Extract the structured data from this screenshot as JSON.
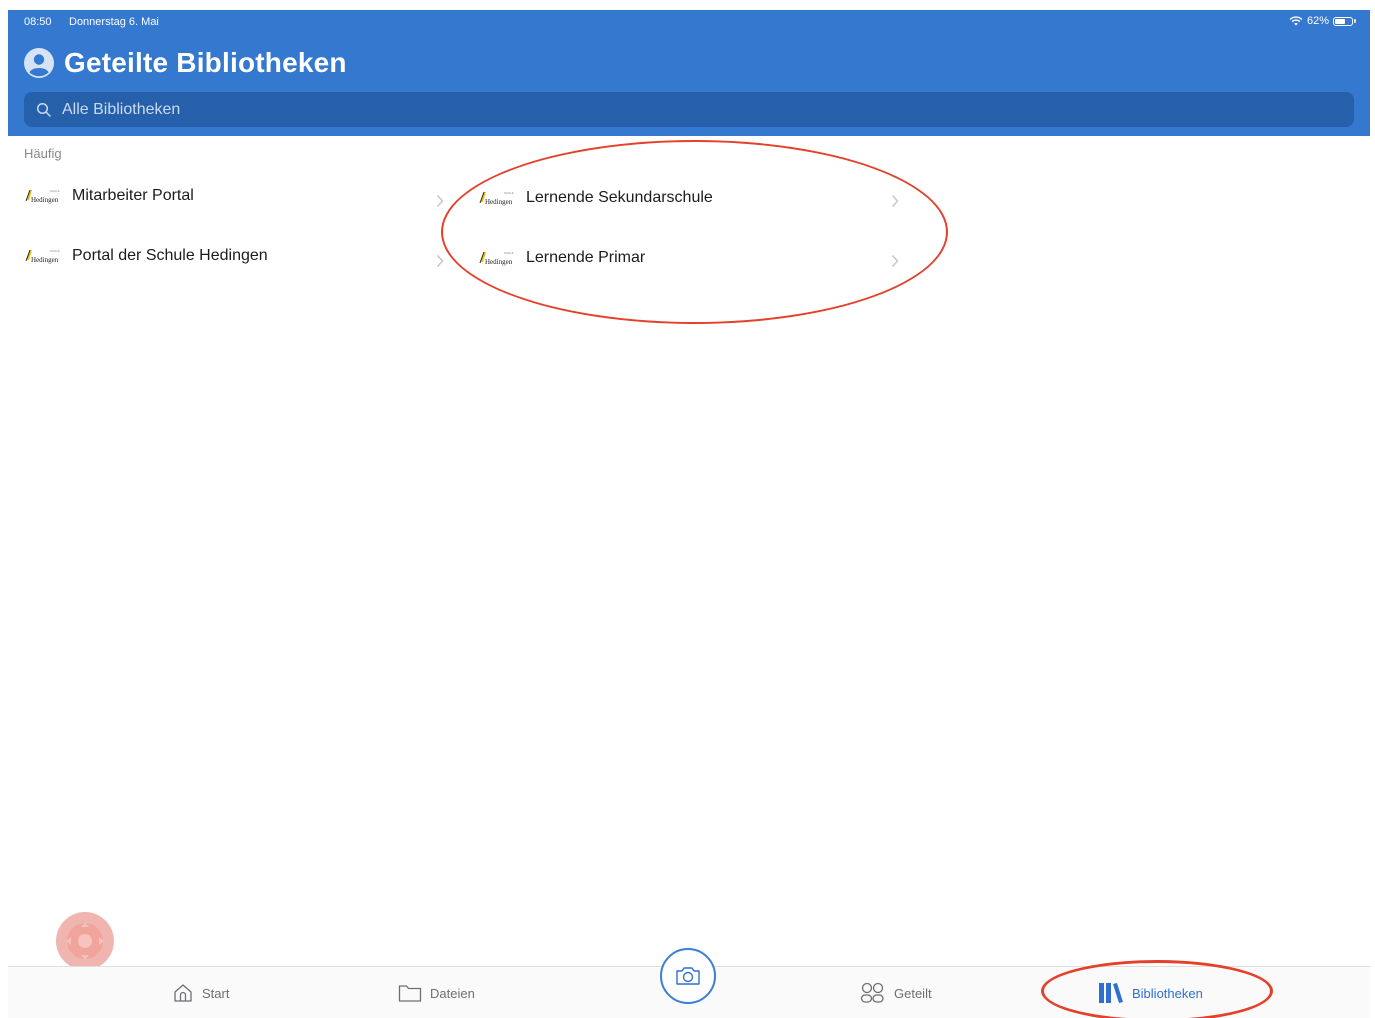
{
  "statusbar": {
    "time": "08:50",
    "date": "Donnerstag 6. Mai",
    "battery": "62%",
    "battery_level": 0.62
  },
  "header": {
    "title": "Geteilte Bibliotheken"
  },
  "search": {
    "placeholder": "Alle Bibliotheken"
  },
  "section": {
    "label": "Häufig"
  },
  "libraries": [
    {
      "label": "Mitarbeiter Portal"
    },
    {
      "label": "Lernende Sekundarschule"
    },
    {
      "label": "Portal der Schule Hedingen"
    },
    {
      "label": "Lernende Primar"
    }
  ],
  "tabbar": {
    "start": "Start",
    "dateien": "Dateien",
    "geteilt": "Geteilt",
    "bibliotheken": "Bibliotheken"
  },
  "colors": {
    "header": "#3478cf",
    "accent": "#2f6fd1",
    "annotation": "#e4402a"
  },
  "icons": [
    "avatar-icon",
    "search-icon",
    "hedingen-logo",
    "chevron-right-icon",
    "home-icon",
    "folder-icon",
    "camera-icon",
    "people-icon",
    "library-icon",
    "assistive-touch-icon"
  ]
}
